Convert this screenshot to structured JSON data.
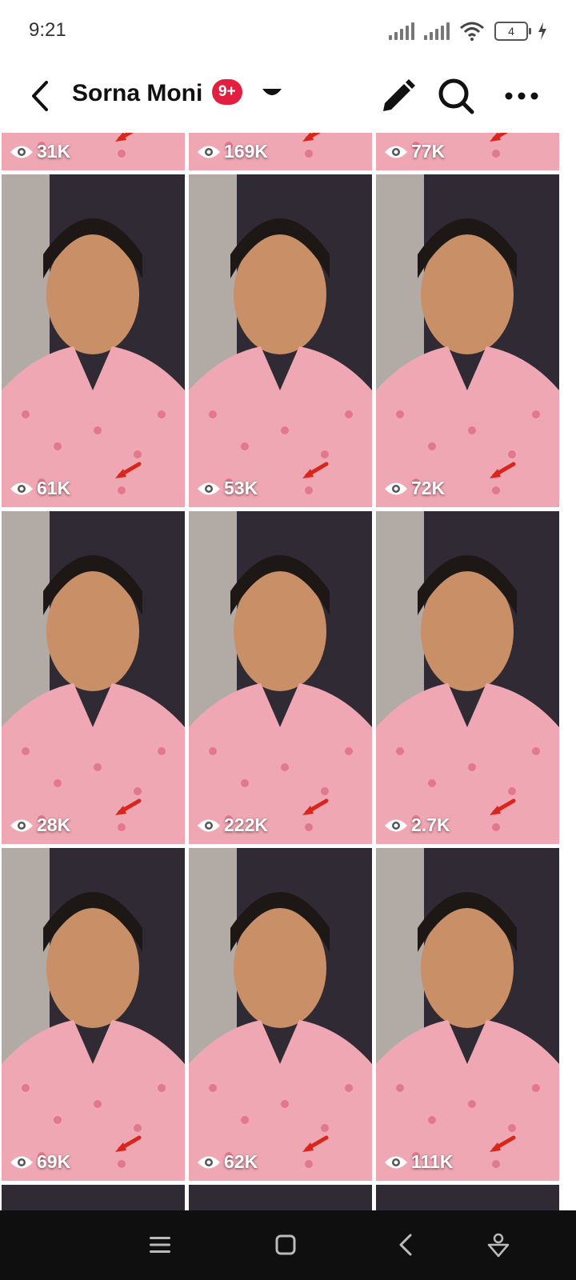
{
  "status_bar": {
    "time": "9:21",
    "battery_level": "4"
  },
  "header": {
    "title": "Sorna Moni",
    "badge": "9+",
    "badge_color": "#e41e3f",
    "icons": [
      "back-arrow-icon",
      "dropdown-caret-icon",
      "edit-pencil-icon",
      "search-icon",
      "more-options-icon"
    ]
  },
  "videos": [
    {
      "views": "31K"
    },
    {
      "views": "169K"
    },
    {
      "views": "77K"
    },
    {
      "views": "61K"
    },
    {
      "views": "53K"
    },
    {
      "views": "72K"
    },
    {
      "views": "28K"
    },
    {
      "views": "222K"
    },
    {
      "views": "2.7K"
    },
    {
      "views": "69K"
    },
    {
      "views": "62K"
    },
    {
      "views": "111K"
    }
  ],
  "nav_bar": {
    "icons": [
      "menu-icon",
      "home-square-icon",
      "back-icon",
      "assistant-icon"
    ]
  },
  "colors": {
    "dress_pink": "#f0a7b4",
    "room_dark": "#2f2a33",
    "arrow_red": "#d9261c"
  }
}
